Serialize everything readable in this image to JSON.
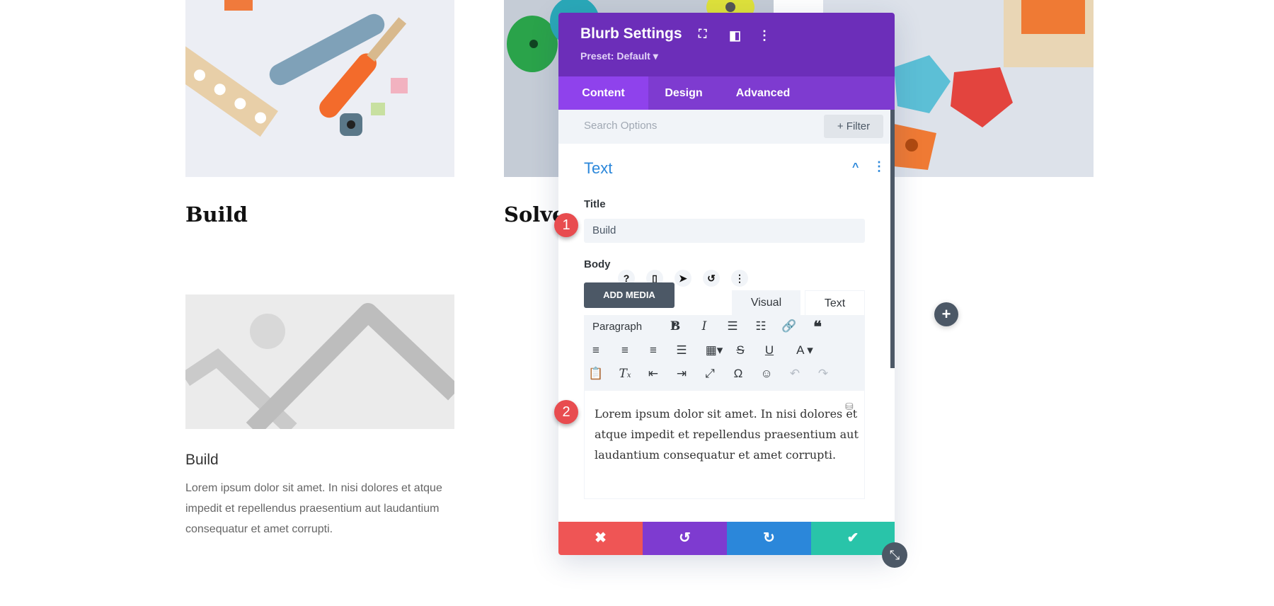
{
  "page": {
    "columns": [
      {
        "heading": "Build"
      },
      {
        "heading": "Solve"
      }
    ],
    "blurb": {
      "title": "Build",
      "body": "Lorem ipsum dolor sit amet. In nisi dolores et atque impedit et repellendus praesentium aut laudantium consequatur et amet corrupti."
    },
    "add_icon": "plus-icon"
  },
  "panel": {
    "title": "Blurb Settings",
    "preset": "Preset: Default ▾",
    "tabs": [
      {
        "label": "Content",
        "active": true
      },
      {
        "label": "Design",
        "active": false
      },
      {
        "label": "Advanced",
        "active": false
      }
    ],
    "search_placeholder": "Search Options",
    "filter_label": "+ Filter",
    "section_title": "Text",
    "title_label": "Title",
    "title_value": "Build",
    "body_label": "Body",
    "add_media": "ADD MEDIA",
    "editor_tabs": {
      "visual": "Visual",
      "text": "Text"
    },
    "paragraph_select": "Paragraph",
    "body_value": "Lorem ipsum dolor sit amet. In nisi dolores et atque impedit et repellendus praesentium aut laudantium consequatur et amet corrupti.",
    "colors": {
      "header": "#6c2eb9",
      "tabs": "#7e3bd0",
      "cancel": "#ef5555",
      "undo": "#7e3bd0",
      "redo": "#2b87da",
      "save": "#29c4a9"
    }
  },
  "annotations": {
    "one": "1",
    "two": "2"
  }
}
